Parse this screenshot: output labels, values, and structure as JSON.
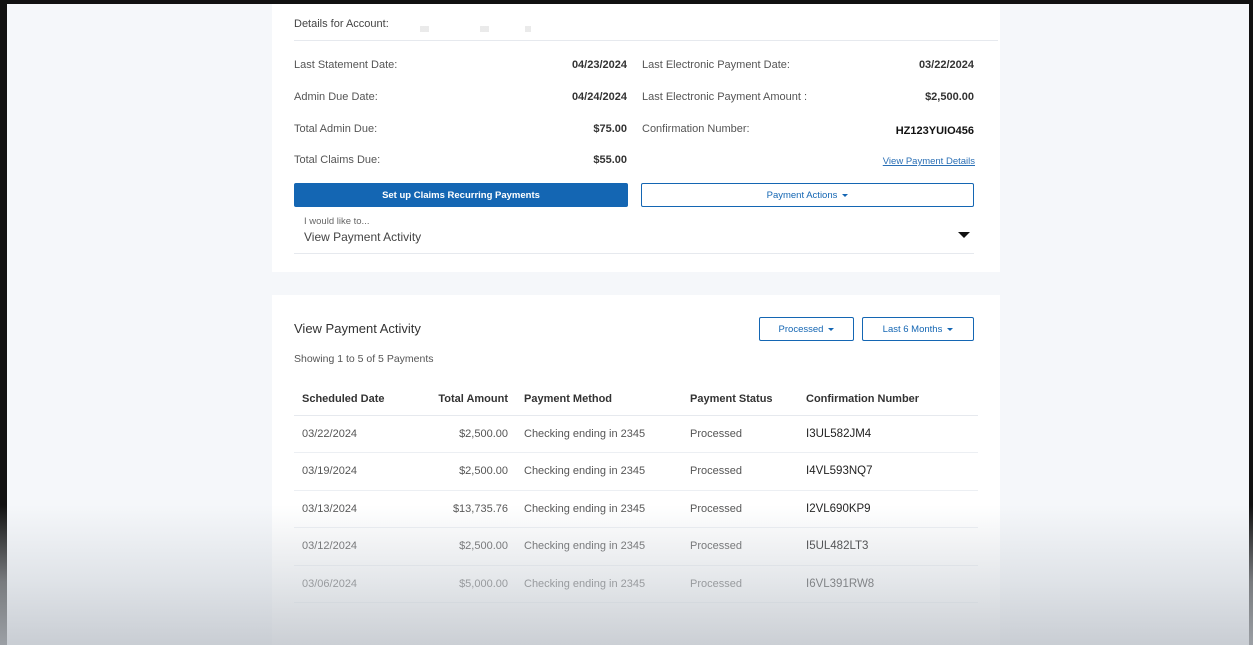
{
  "account": {
    "header": "Details for Account:"
  },
  "summary_left": [
    {
      "label": "Last Statement Date:",
      "value": "04/23/2024"
    },
    {
      "label": "Admin Due Date:",
      "value": "04/24/2024"
    },
    {
      "label": "Total Admin Due:",
      "value": "$75.00"
    },
    {
      "label": "Total Claims Due:",
      "value": "$55.00"
    }
  ],
  "summary_right": [
    {
      "label": "Last Electronic Payment Date:",
      "value": "03/22/2024"
    },
    {
      "label": "Last Electronic Payment Amount :",
      "value": "$2,500.00"
    },
    {
      "label": "Confirmation Number:",
      "value": "HZ123YUIO456"
    }
  ],
  "links": {
    "view_payment_details": "View Payment Details"
  },
  "buttons": {
    "recurring": "Set up Claims Recurring Payments",
    "payment_actions": "Payment Actions"
  },
  "select": {
    "caption": "I would like to...",
    "value": "View Payment Activity"
  },
  "activity": {
    "title": "View Payment Activity",
    "showing": "Showing 1 to 5 of 5 Payments",
    "filter_status": "Processed",
    "filter_range": "Last 6 Months",
    "columns": [
      "Scheduled Date",
      "Total Amount",
      "Payment Method",
      "Payment Status",
      "Confirmation Number"
    ],
    "rows": [
      {
        "date": "03/22/2024",
        "amount": "$2,500.00",
        "method": "Checking ending in 2345",
        "status": "Processed",
        "conf": "I3UL582JM4"
      },
      {
        "date": "03/19/2024",
        "amount": "$2,500.00",
        "method": "Checking ending in 2345",
        "status": "Processed",
        "conf": "I4VL593NQ7"
      },
      {
        "date": "03/13/2024",
        "amount": "$13,735.76",
        "method": "Checking ending in 2345",
        "status": "Processed",
        "conf": "I2VL690KP9"
      },
      {
        "date": "03/12/2024",
        "amount": "$2,500.00",
        "method": "Checking ending in 2345",
        "status": "Processed",
        "conf": "I5UL482LT3"
      },
      {
        "date": "03/06/2024",
        "amount": "$5,000.00",
        "method": "Checking ending in 2345",
        "status": "Processed",
        "conf": "I6VL391RW8"
      }
    ]
  },
  "colors": {
    "primary": "#1466b3",
    "background": "#f5f7fa"
  }
}
